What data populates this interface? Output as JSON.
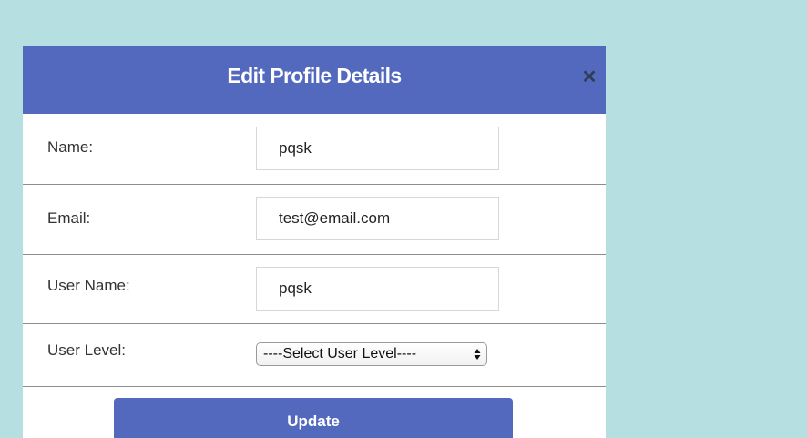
{
  "modal": {
    "title": "Edit Profile Details",
    "close_icon": "close-icon"
  },
  "form": {
    "name": {
      "label": "Name:",
      "value": "pqsk"
    },
    "email": {
      "label": "Email:",
      "value": "test@email.com"
    },
    "username": {
      "label": "User Name:",
      "value": "pqsk"
    },
    "user_level": {
      "label": "User Level:",
      "selected": "----Select User Level----"
    }
  },
  "actions": {
    "update_label": "Update"
  },
  "colors": {
    "page_background": "#b6dfe1",
    "header_background": "#5269be",
    "button_background": "#5269be",
    "close_icon": "#2f3b57"
  }
}
